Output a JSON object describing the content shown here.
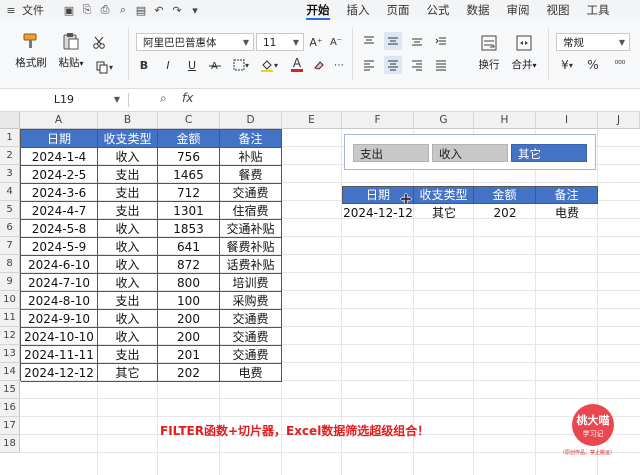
{
  "menu": {
    "file": "文件",
    "tabs": [
      "开始",
      "插入",
      "页面",
      "公式",
      "数据",
      "审阅",
      "视图",
      "工具"
    ],
    "active_tab": "开始"
  },
  "ribbon": {
    "format_painter": "格式刷",
    "paste": "粘贴",
    "font_name": "阿里巴巴普惠体",
    "font_size": "11",
    "bold": "B",
    "italic": "I",
    "underline": "U",
    "font_color_glyph": "A",
    "wrap": "换行",
    "merge": "合并",
    "number_format": "常规",
    "currency": "¥",
    "percent": "%"
  },
  "formula_bar": {
    "name_box": "L19",
    "fx": "fx"
  },
  "columns": [
    "A",
    "B",
    "C",
    "D",
    "E",
    "F",
    "G",
    "H",
    "I",
    "J"
  ],
  "rows": [
    "1",
    "2",
    "3",
    "4",
    "5",
    "6",
    "7",
    "8",
    "9",
    "10",
    "11",
    "12",
    "13",
    "14",
    "15",
    "16",
    "17",
    "18"
  ],
  "source_table": {
    "headers": [
      "日期",
      "收支类型",
      "金额",
      "备注"
    ],
    "rows": [
      [
        "2024-1-4",
        "收入",
        "756",
        "补贴"
      ],
      [
        "2024-2-5",
        "支出",
        "1465",
        "餐费"
      ],
      [
        "2024-3-6",
        "支出",
        "712",
        "交通费"
      ],
      [
        "2024-4-7",
        "支出",
        "1301",
        "住宿费"
      ],
      [
        "2024-5-8",
        "收入",
        "1853",
        "交通补贴"
      ],
      [
        "2024-5-9",
        "收入",
        "641",
        "餐费补贴"
      ],
      [
        "2024-6-10",
        "收入",
        "872",
        "话费补贴"
      ],
      [
        "2024-7-10",
        "收入",
        "800",
        "培训费"
      ],
      [
        "2024-8-10",
        "支出",
        "100",
        "采购费"
      ],
      [
        "2024-9-10",
        "收入",
        "200",
        "交通费"
      ],
      [
        "2024-10-10",
        "收入",
        "200",
        "交通费"
      ],
      [
        "2024-11-11",
        "支出",
        "201",
        "交通费"
      ],
      [
        "2024-12-12",
        "其它",
        "202",
        "电费"
      ]
    ]
  },
  "slicer": {
    "items": [
      "支出",
      "收入",
      "其它"
    ],
    "selected": "其它"
  },
  "result_table": {
    "headers": [
      "日期",
      "收支类型",
      "金额",
      "备注"
    ],
    "rows": [
      [
        "2024-12-12",
        "其它",
        "202",
        "电费"
      ]
    ]
  },
  "caption": "FILTER函数+切片器，Excel数据筛选超级组合！",
  "watermark": {
    "name": "桃大喵",
    "sub": "学习记",
    "note": "（原创作品，禁止搬运）"
  },
  "colors": {
    "header_blue": "#4472c4",
    "slicer_unselected": "#c8c8c8",
    "caption_red": "#e21e1e",
    "accent": "#2e6ce6"
  }
}
